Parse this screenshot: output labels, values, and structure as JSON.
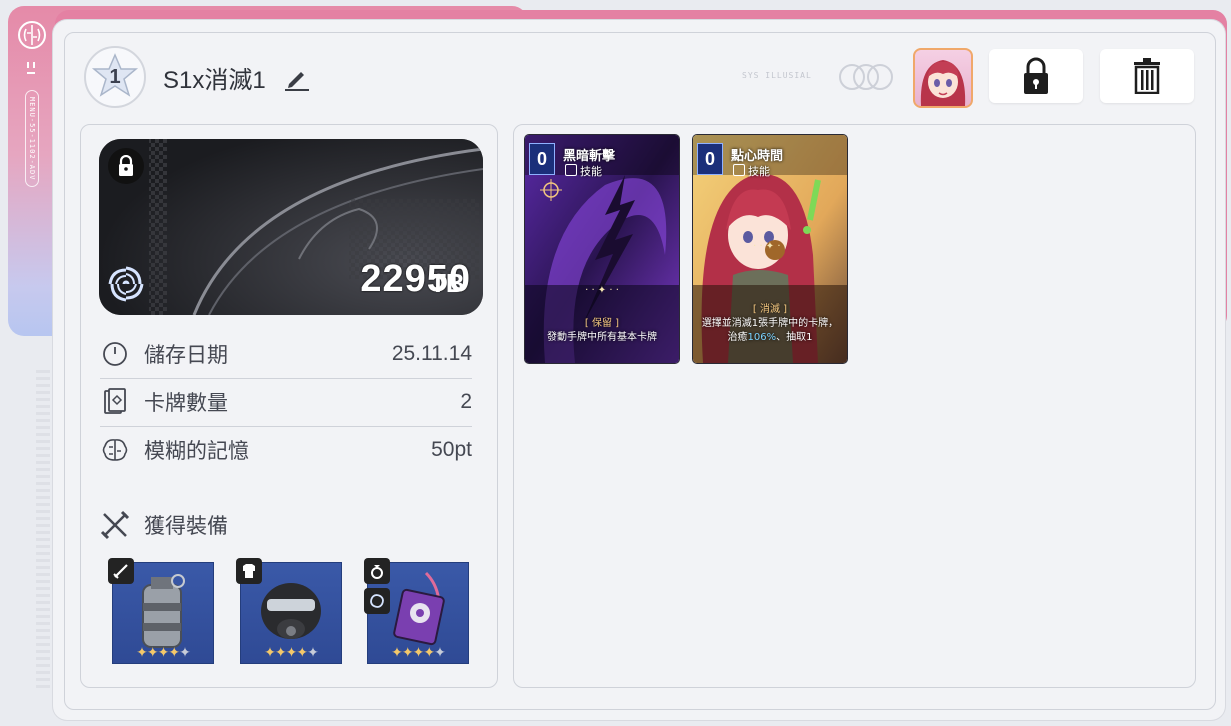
{
  "sidebar": {
    "vertical_text": "MENU-55-1102-ADV"
  },
  "header": {
    "rank": "1",
    "deck_title": "S1x消滅1",
    "deco_text": "SYS ILLUSIAL"
  },
  "save": {
    "value": "22950",
    "unit": "TB"
  },
  "stats": [
    {
      "label": "儲存日期",
      "value": "25.11.14",
      "icon": "clock-icon"
    },
    {
      "label": "卡牌數量",
      "value": "2",
      "icon": "card-icon"
    },
    {
      "label": "模糊的記憶",
      "value": "50pt",
      "icon": "brain-icon"
    }
  ],
  "equipment": {
    "title": "獲得裝備",
    "items": [
      {
        "name": "grenade",
        "stars": 4,
        "max_stars": 5,
        "badge": "weapon-icon"
      },
      {
        "name": "gas-mask-helmet",
        "stars": 4,
        "max_stars": 5,
        "badge": "armor-icon"
      },
      {
        "name": "pendant-device",
        "stars": 4,
        "max_stars": 5,
        "badge": "ring-icon"
      }
    ]
  },
  "cards": [
    {
      "cost": "0",
      "name": "黑暗斬擊",
      "type": "技能",
      "keyword": "[ 保留 ]",
      "desc": "發動手牌中所有基本卡牌",
      "bg": "#3b1a6e"
    },
    {
      "cost": "0",
      "name": "點心時間",
      "type": "技能",
      "keyword": "[ 消滅 ]",
      "desc_pre": "選擇並消滅1張手牌中的卡牌，治癒",
      "desc_num": "106%",
      "desc_post": "、抽取1",
      "bg": "#6a4a3a"
    }
  ],
  "colors": {
    "accent_pink": "#e481a3",
    "panel_bg": "#f2f3f6",
    "star_gold": "#f4c86a"
  }
}
